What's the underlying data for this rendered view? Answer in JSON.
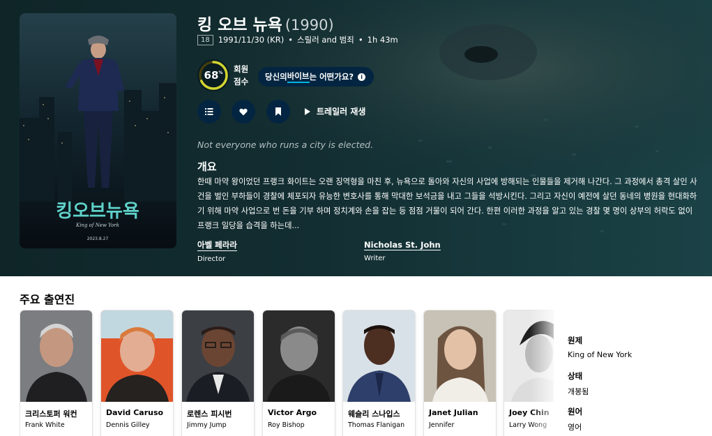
{
  "movie": {
    "title": "킹 오브 뉴욕",
    "year": "(1990)",
    "certification": "18",
    "release": "1991/11/30 (KR)",
    "genres": "스릴러 and 범죄",
    "runtime": "1h 43m",
    "score": "68",
    "score_pct_sign": "%",
    "score_fraction": 0.68,
    "score_label": "회원 점수",
    "vibe_prefix": "당신의 ",
    "vibe_link": "바이브",
    "vibe_suffix": "는 어떤가요?",
    "info_icon": "i",
    "trailer_label": "트레일러 재생",
    "tagline": "Not everyone who runs a city is elected.",
    "overview_heading": "개요",
    "overview": "한때 마약 왕이었던 프랭크 화이트는 오랜 징역형을 마친 후, 뉴욕으로 돌아와 자신의 사업에 방해되는 인물들을 제거해 나간다. 그 과정에서 총격 살인 사건을 벌인 부하들이 경찰에 체포되자 유능한 변호사를 통해 막대한 보석금을 내고 그들을 석방시킨다. 그리고 자신이 예전에 살던 동네의 병원을 현대화하기 위해 마약 사업으로 번 돈을 기부 하며 정치계와 손을 잡는 등 점점 거물이 되어 간다. 한편 이러한 과정을 알고 있는 경찰 몇 명이 상부의 허락도 없이 프랭크 일당을 습격을 하는데...",
    "crew": [
      {
        "name": "아벨 페라라",
        "job": "Director"
      },
      {
        "name": "Nicholas St. John",
        "job": "Writer"
      }
    ],
    "poster": {
      "top_text": "킹오브뉴욕",
      "english": "King of New York",
      "date": "2023.8.27"
    }
  },
  "cast_section": {
    "heading": "주요 출연진",
    "cast": [
      {
        "name": "크리스토퍼 워컨",
        "role": "Frank White"
      },
      {
        "name": "David Caruso",
        "role": "Dennis Gilley"
      },
      {
        "name": "로렌스 피시번",
        "role": "Jimmy Jump"
      },
      {
        "name": "Victor Argo",
        "role": "Roy Bishop"
      },
      {
        "name": "웨슬리 스나입스",
        "role": "Thomas Flanigan"
      },
      {
        "name": "Janet Julian",
        "role": "Jennifer"
      },
      {
        "name": "Joey Chin",
        "role": "Larry Wong"
      }
    ]
  },
  "side_facts": [
    {
      "label": "원제",
      "value": "King of New York"
    },
    {
      "label": "상태",
      "value": "개봉됨"
    },
    {
      "label": "원어",
      "value": "영어"
    }
  ],
  "colors": {
    "accent": "#01b4e4",
    "score_ring": "#d2d531",
    "score_track": "#423d0f",
    "button_bg": "#032541",
    "hero_bg": "#132e32"
  },
  "icons": [
    "list-icon",
    "heart-icon",
    "bookmark-icon",
    "play-icon",
    "info-icon"
  ]
}
